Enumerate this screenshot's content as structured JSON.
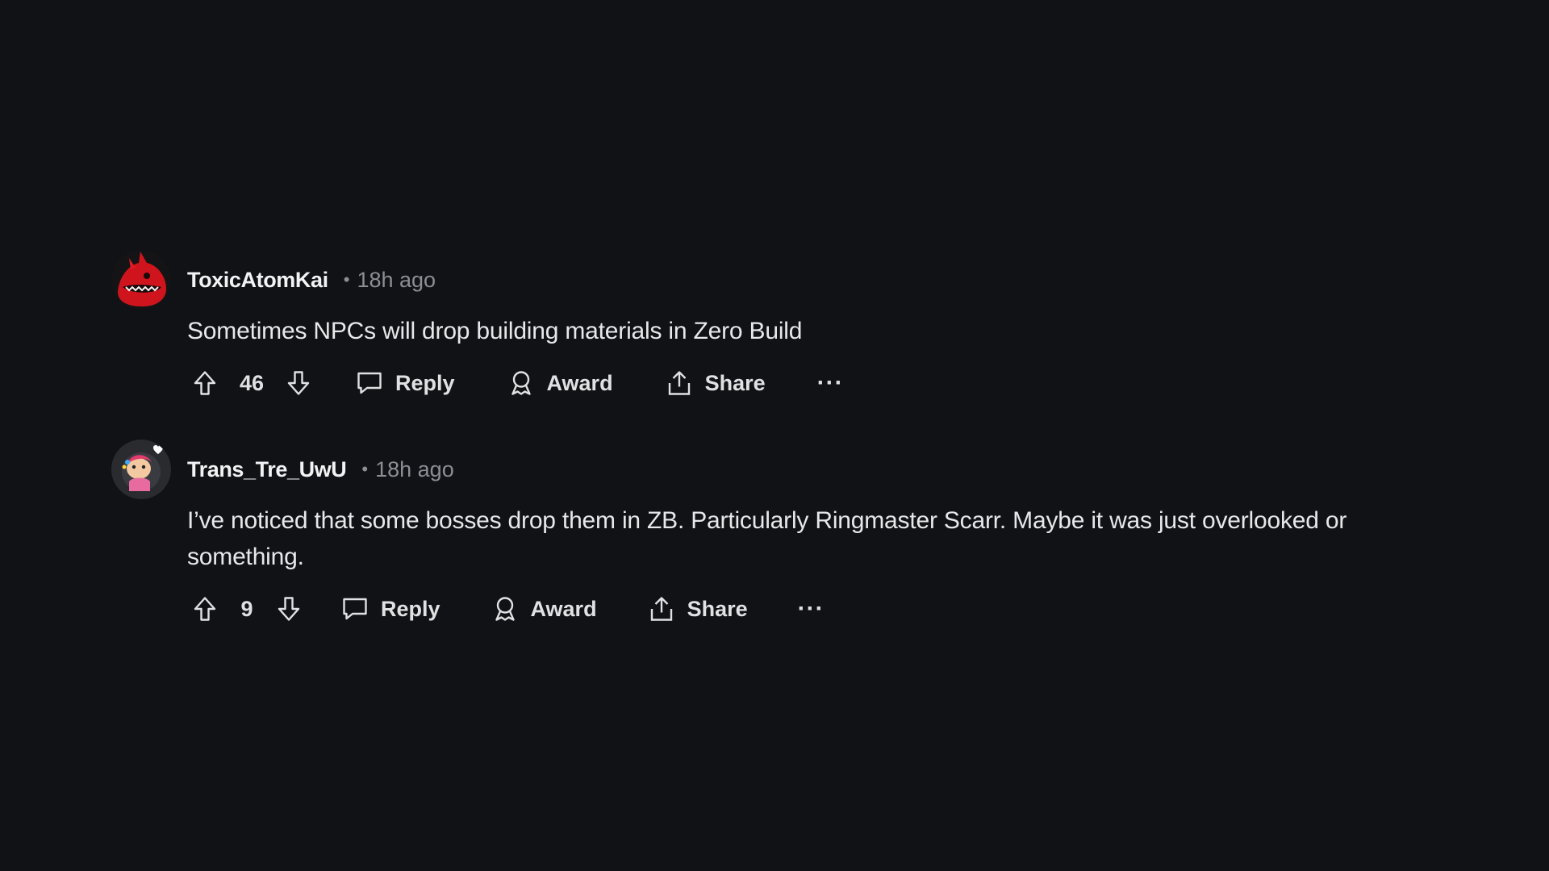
{
  "comments": [
    {
      "author": "ToxicAtomKai",
      "separator": "•",
      "time": "18h ago",
      "body": "Sometimes NPCs will drop building materials in Zero Build",
      "score": "46",
      "avatar_icon": "red-creature-avatar",
      "actions": {
        "reply": "Reply",
        "award": "Award",
        "share": "Share",
        "more": "···"
      }
    },
    {
      "author": "Trans_Tre_UwU",
      "separator": "•",
      "time": "18h ago",
      "body": "I’ve noticed that some bosses drop them in ZB. Particularly Ringmaster Scarr. Maybe it was just overlooked or something.",
      "score": "9",
      "avatar_icon": "snoo-avatar",
      "actions": {
        "reply": "Reply",
        "award": "Award",
        "share": "Share",
        "more": "···"
      }
    }
  ],
  "colors": {
    "background": "#111215",
    "text": "#e6e8ea",
    "muted": "#8b8f94",
    "avatar1": "#d0141d"
  }
}
